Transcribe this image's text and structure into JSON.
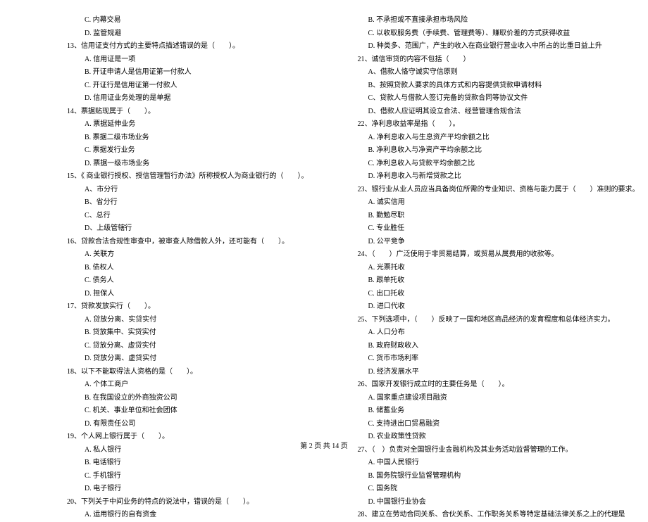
{
  "left": {
    "pre_opts": [
      "C. 内幕交易",
      "D. 监管规避"
    ],
    "q13": {
      "stem": "13、信用证支付方式的主要特点描述错误的是（　　）。",
      "opts": [
        "A. 信用证是一项",
        "B. 开证申请人是信用证第一付款人",
        "C. 开证行是信用证第一付款人",
        "D. 信用证业务处理的是单据"
      ]
    },
    "q14": {
      "stem": "14、票据贴现属于（　　）。",
      "opts": [
        "A. 票据延伸业务",
        "B. 票据二级市场业务",
        "C. 票据发行业务",
        "D. 票据一级市场业务"
      ]
    },
    "q15": {
      "stem": "15、《 商业银行授权、授信管理暂行办法》所称授权人为商业银行的（　　）。",
      "opts": [
        "A、市分行",
        "B、省分行",
        "C、总行",
        "D、上级管辖行"
      ]
    },
    "q16": {
      "stem": "16、贷款合法合规性审查中，被审查人除借款人外，还可能有（　　）。",
      "opts": [
        "A. 关联方",
        "B. 债权人",
        "C. 债务人",
        "D. 担保人"
      ]
    },
    "q17": {
      "stem": "17、贷款发放实行（　　）。",
      "opts": [
        "A. 贷放分离、实贷实付",
        "B. 贷放集中、实贷实付",
        "C. 贷放分离、虚贷实付",
        "D. 贷放分离、虚贷实付"
      ]
    },
    "q18": {
      "stem": "18、以下不能取得法人资格的是（　　）。",
      "opts": [
        "A. 个体工商户",
        "B. 在我国设立的外商独资公司",
        "C. 机关、事业单位和社会团体",
        "D. 有限责任公司"
      ]
    },
    "q19": {
      "stem": "19、个人网上银行属于（　　）。",
      "opts": [
        "A. 私人银行",
        "B. 电话银行",
        "C. 手机银行",
        "D. 电子银行"
      ]
    },
    "q20": {
      "stem": "20、下列关于中间业务的特点的说法中，错误的是（　　）。",
      "opts": [
        "A. 运用银行的自有资金"
      ]
    }
  },
  "right": {
    "pre_opts": [
      "B. 不承担或不直接承担市场风险",
      "C. 以收取服务费（手续费、管理费等）、赚取价差的方式获得收益",
      "D. 种类多、范围广，产生的收入在商业银行营业收入中所占的比重日益上升"
    ],
    "q21": {
      "stem": "21、诚信审贷的内容不包括（　　）",
      "opts": [
        "A、借款人恪守诚实守信原则",
        "B、按照贷款人要求的具体方式和内容提供贷款申请材料",
        "C、贷款人与借款人签订完备的贷款合同等协议文件",
        "D、借款人应证明其设立合法、经营管理合规合法"
      ]
    },
    "q22": {
      "stem": "22、净利息收益率是指（　　）。",
      "opts": [
        "A. 净利息收入与生息资产平均余额之比",
        "B. 净利息收入与净资产平均余额之比",
        "C. 净利息收入与贷款平均余额之比",
        "D. 净利息收入与新增贷款之比"
      ]
    },
    "q23": {
      "stem": "23、银行业从业人员应当具备岗位所需的专业知识、资格与能力属于（　　）准则的要求。",
      "opts": [
        "A. 诚实信用",
        "B. 勤勉尽职",
        "C. 专业胜任",
        "D. 公平竞争"
      ]
    },
    "q24": {
      "stem": "24、（　　）广泛使用于非贸易结算，或贸易从属费用的收款等。",
      "opts": [
        "A. 光票托收",
        "B. 跟单托收",
        "C. 出口托收",
        "D. 进口代收"
      ]
    },
    "q25": {
      "stem": "25、下列选项中，（　　）反映了一国和地区商品经济的发育程度和总体经济实力。",
      "opts": [
        "A. 人口分布",
        "B. 政府财政收入",
        "C. 货币市场利率",
        "D. 经济发展水平"
      ]
    },
    "q26": {
      "stem": "26、国家开发银行成立时的主要任务是（　　）。",
      "opts": [
        "A. 国家重点建设项目融资",
        "B. 储蓄业务",
        "C. 支持进出口贸易融资",
        "D. 农业政策性贷款"
      ]
    },
    "q27": {
      "stem": "27、（　）负责对全国银行业金融机构及其业务活动监督管理的工作。",
      "opts": [
        "A. 中国人民银行",
        "B. 国务院银行业监督管理机构",
        "C. 国务院",
        "D. 中国银行业协会"
      ]
    },
    "q28": {
      "stem": "28、建立在劳动合同关系、合伙关系、工作职务关系等特定基础法律关系之上的代理是"
    }
  },
  "footer": "第 2 页 共 14 页"
}
